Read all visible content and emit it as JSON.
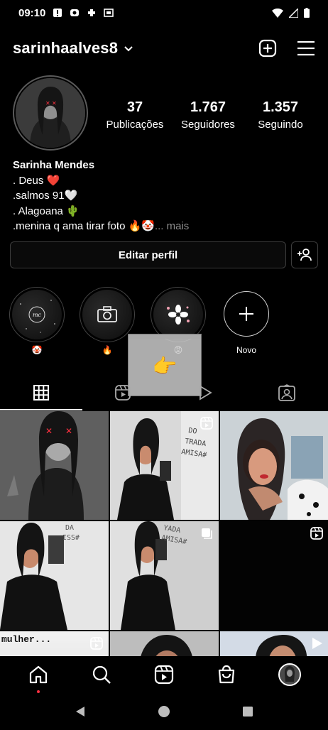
{
  "status_bar": {
    "time": "09:10"
  },
  "header": {
    "username": "sarinhaalves8"
  },
  "stats": [
    {
      "value": "37",
      "label": "Publicações"
    },
    {
      "value": "1.767",
      "label": "Seguidores"
    },
    {
      "value": "1.357",
      "label": "Seguindo"
    }
  ],
  "bio": {
    "name": "Sarinha Mendes",
    "lines": [
      ". Deus ❤️",
      ".salmos 91🤍",
      ". Alagoana 🌵",
      ".menina q ama tirar foto 🔥🤡"
    ],
    "more": "... mais"
  },
  "buttons": {
    "edit_profile": "Editar perfil"
  },
  "highlights": [
    {
      "label": "🤡",
      "icon": "mc-text-icon",
      "inner_text": "mc"
    },
    {
      "label": "🔥",
      "icon": "camera-icon"
    },
    {
      "label": "😡",
      "icon": "flower-icon"
    },
    {
      "label": "Novo",
      "icon": "plus-icon"
    }
  ],
  "overlay": {
    "emoji": "👉"
  },
  "grid": {
    "captions": {
      "row3_col1": "mulher..."
    }
  },
  "colors": {
    "background": "#000000",
    "accent_dot": "#ff3040",
    "heart": "#e0245e"
  }
}
